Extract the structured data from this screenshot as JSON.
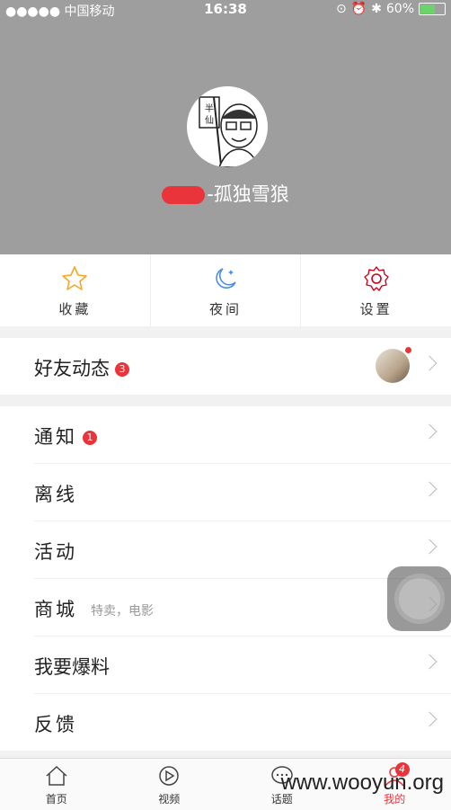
{
  "status": {
    "carrier": "●●●●● 中国移动",
    "time": "16:38",
    "battery": "60%"
  },
  "profile": {
    "name": "-孤独雪狼",
    "avatar_text": "半仙"
  },
  "quick_actions": [
    {
      "label": "收藏",
      "icon": "star-icon"
    },
    {
      "label": "夜间",
      "icon": "moon-icon"
    },
    {
      "label": "设置",
      "icon": "gear-icon"
    }
  ],
  "friends": {
    "label": "好友动态",
    "badge": "3"
  },
  "menu": [
    {
      "label": "通知",
      "badge": "1",
      "sub": ""
    },
    {
      "label": "离线",
      "badge": "",
      "sub": ""
    },
    {
      "label": "活动",
      "badge": "",
      "sub": ""
    },
    {
      "label": "商城",
      "badge": "",
      "sub": "特卖，电影"
    },
    {
      "label": "我要爆料",
      "badge": "",
      "sub": ""
    },
    {
      "label": "反馈",
      "badge": "",
      "sub": ""
    }
  ],
  "tabs": [
    {
      "label": "首页",
      "icon": "home-icon"
    },
    {
      "label": "视频",
      "icon": "play-icon"
    },
    {
      "label": "话题",
      "icon": "chat-icon"
    },
    {
      "label": "我的",
      "icon": "user-icon",
      "badge": "4"
    }
  ],
  "watermark": "www.wooyun.org",
  "colors": {
    "accent": "#e8343a",
    "header_bg": "#9e9e9e",
    "star": "#f5a623",
    "moon": "#4a90e2",
    "gear": "#d0021b"
  }
}
